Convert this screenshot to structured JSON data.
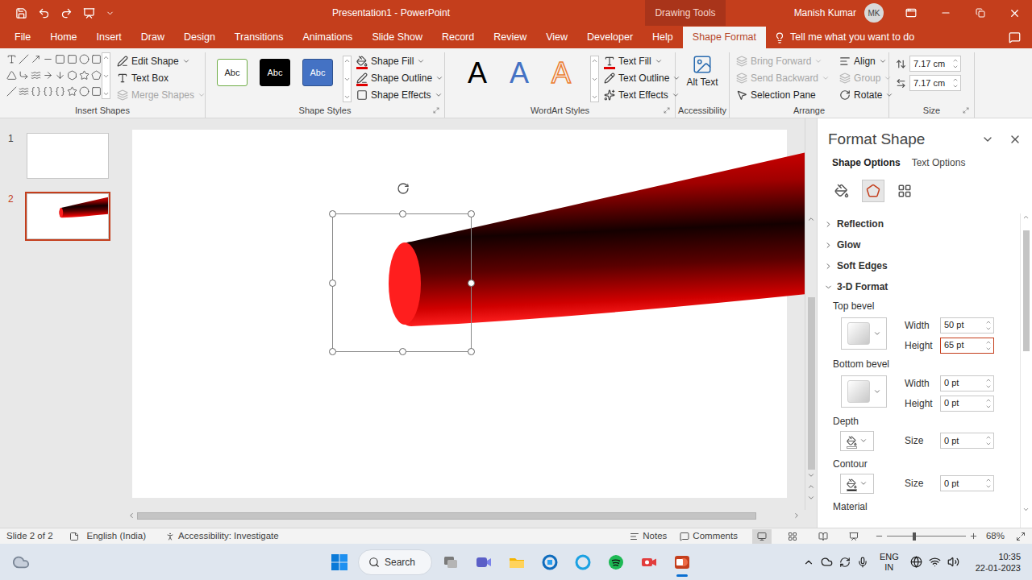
{
  "title_bar": {
    "title": "Presentation1 - PowerPoint",
    "context_label": "Drawing Tools",
    "user_name": "Manish Kumar",
    "user_initials": "MK"
  },
  "tabs": [
    {
      "label": "File",
      "selected": false
    },
    {
      "label": "Home",
      "selected": false
    },
    {
      "label": "Insert",
      "selected": false
    },
    {
      "label": "Draw",
      "selected": false
    },
    {
      "label": "Design",
      "selected": false
    },
    {
      "label": "Transitions",
      "selected": false
    },
    {
      "label": "Animations",
      "selected": false
    },
    {
      "label": "Slide Show",
      "selected": false
    },
    {
      "label": "Record",
      "selected": false
    },
    {
      "label": "Review",
      "selected": false
    },
    {
      "label": "View",
      "selected": false
    },
    {
      "label": "Developer",
      "selected": false
    },
    {
      "label": "Help",
      "selected": false
    },
    {
      "label": "Shape Format",
      "selected": true
    }
  ],
  "tell_me": {
    "placeholder": "Tell me what you want to do"
  },
  "ribbon": {
    "insert_shapes": {
      "label": "Insert Shapes",
      "commands": [
        {
          "label": "Edit Shape",
          "disabled": false,
          "dropdown": true
        },
        {
          "label": "Text Box",
          "disabled": false,
          "dropdown": false
        },
        {
          "label": "Merge Shapes",
          "disabled": true,
          "dropdown": true
        }
      ]
    },
    "shape_styles": {
      "label": "Shape Styles",
      "presets": [
        {
          "text": "Abc",
          "color": "#ffffff",
          "border": "#70ad47",
          "text_color": "#262626"
        },
        {
          "text": "Abc",
          "color": "#000000",
          "border": "#000000",
          "text_color": "#ffffff"
        },
        {
          "text": "Abc",
          "color": "#4472c4",
          "border": "#2f528f",
          "text_color": "#ffffff"
        }
      ],
      "commands": [
        {
          "label": "Shape Fill",
          "disabled": false,
          "dropdown": true
        },
        {
          "label": "Shape Outline",
          "disabled": false,
          "dropdown": true
        },
        {
          "label": "Shape Effects",
          "disabled": false,
          "dropdown": true
        }
      ]
    },
    "wordart_styles": {
      "label": "WordArt Styles",
      "presets": [
        {
          "text": "A",
          "kind": "fill",
          "color": "#000000"
        },
        {
          "text": "A",
          "kind": "fill",
          "color": "#4472c4"
        },
        {
          "text": "A",
          "kind": "outline",
          "color": "#ed7d31"
        }
      ],
      "commands": [
        {
          "label": "Text Fill",
          "disabled": false,
          "dropdown": true
        },
        {
          "label": "Text Outline",
          "disabled": false,
          "dropdown": true
        },
        {
          "label": "Text Effects",
          "disabled": false,
          "dropdown": true
        }
      ]
    },
    "accessibility": {
      "label": "Accessibility",
      "command": "Alt Text"
    },
    "arrange": {
      "label": "Arrange",
      "commands": [
        {
          "label": "Bring Forward",
          "disabled": true,
          "dropdown": true
        },
        {
          "label": "Send Backward",
          "disabled": true,
          "dropdown": true
        },
        {
          "label": "Selection Pane",
          "disabled": false,
          "dropdown": false
        },
        {
          "label": "Align",
          "disabled": false,
          "dropdown": true
        },
        {
          "label": "Group",
          "disabled": true,
          "dropdown": true
        },
        {
          "label": "Rotate",
          "disabled": false,
          "dropdown": true
        }
      ]
    },
    "size": {
      "label": "Size",
      "fields": [
        {
          "kind": "height",
          "value": "7.17 cm"
        },
        {
          "kind": "width",
          "value": "7.17 cm"
        }
      ]
    }
  },
  "slides": [
    {
      "number": "1",
      "selected": false,
      "has_shape": false
    },
    {
      "number": "2",
      "selected": true,
      "has_shape": true
    }
  ],
  "canvas": {
    "shape_selected": true
  },
  "format_pane": {
    "title": "Format Shape",
    "tabs": [
      {
        "label": "Shape Options",
        "selected": true
      },
      {
        "label": "Text Options",
        "selected": false
      }
    ],
    "icon_tabs": [
      {
        "kind": "fill",
        "selected": false
      },
      {
        "kind": "effects",
        "selected": true
      },
      {
        "kind": "size",
        "selected": false
      }
    ],
    "sections": [
      {
        "label": "Reflection",
        "expanded": false
      },
      {
        "label": "Glow",
        "expanded": false
      },
      {
        "label": "Soft Edges",
        "expanded": false
      },
      {
        "label": "3-D Format",
        "expanded": true
      }
    ],
    "bevels": [
      {
        "label": "Top bevel",
        "fields": [
          {
            "label": "Width",
            "value": "50 pt",
            "focused": false
          },
          {
            "label": "Height",
            "value": "65 pt",
            "focused": true
          }
        ]
      },
      {
        "label": "Bottom bevel",
        "fields": [
          {
            "label": "Width",
            "value": "0 pt",
            "focused": false
          },
          {
            "label": "Height",
            "value": "0 pt",
            "focused": false
          }
        ]
      }
    ],
    "color_rows": [
      {
        "label": "Depth",
        "field": {
          "label": "Size",
          "value": "0 pt",
          "focused": false
        },
        "color": "#ffffff"
      },
      {
        "label": "Contour",
        "field": {
          "label": "Size",
          "value": "0 pt",
          "focused": false
        },
        "color": "#000000"
      }
    ],
    "material": "Material"
  },
  "status_bar": {
    "slide": "Slide 2 of 2",
    "language": "English (India)",
    "accessibility": "Accessibility: Investigate",
    "notes": "Notes",
    "comments": "Comments",
    "views": [
      {
        "kind": "normal",
        "selected": true
      },
      {
        "kind": "sorter",
        "selected": false
      },
      {
        "kind": "reading",
        "selected": false
      },
      {
        "kind": "slideshow",
        "selected": false
      }
    ],
    "zoom": "68%",
    "zoom_level": 0.34
  },
  "taskbar": {
    "search": "Search",
    "apps": [
      {
        "kind": "files",
        "active": false
      },
      {
        "kind": "teams",
        "active": false
      },
      {
        "kind": "explorer",
        "active": false
      },
      {
        "kind": "remote",
        "active": false
      },
      {
        "kind": "cortana",
        "active": false
      },
      {
        "kind": "spotify",
        "active": false
      },
      {
        "kind": "recorder",
        "active": false
      },
      {
        "kind": "powerpoint",
        "active": true
      }
    ],
    "language": [
      "ENG",
      "IN"
    ],
    "time": "10:35",
    "date": "22-01-2023"
  }
}
